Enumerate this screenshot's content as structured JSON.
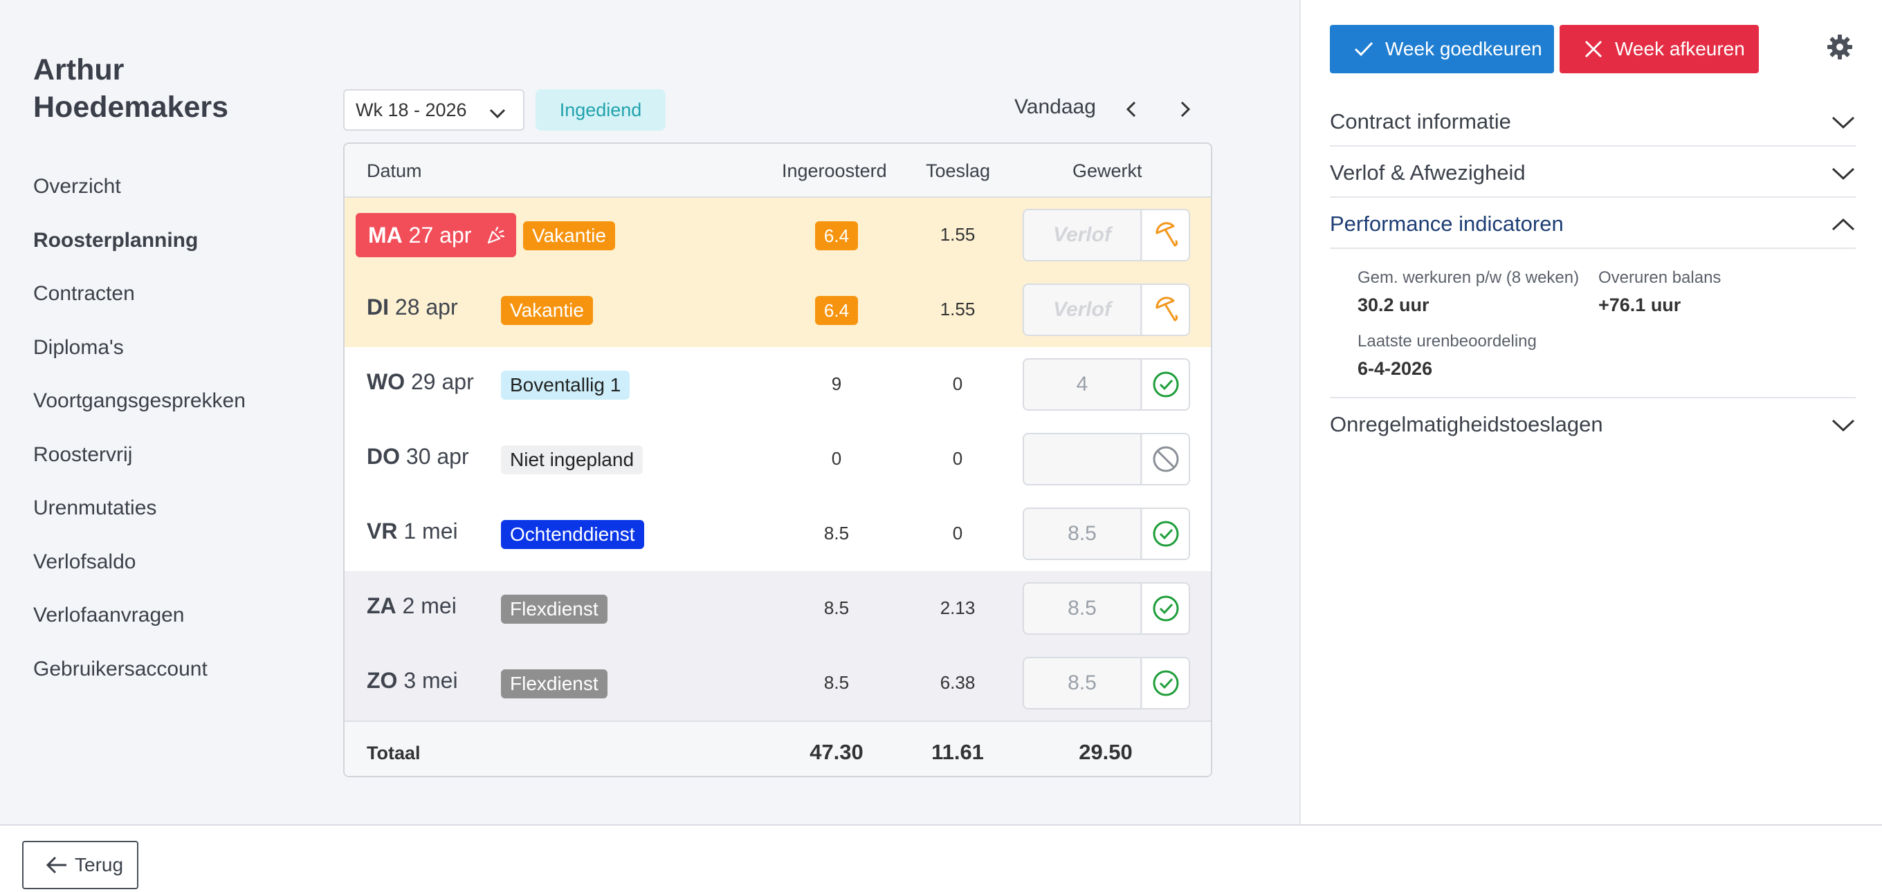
{
  "user": {
    "name_line1": "Arthur",
    "name_line2": "Hoedemakers"
  },
  "nav": [
    {
      "label": "Overzicht"
    },
    {
      "label": "Roosterplanning",
      "active": true
    },
    {
      "label": "Contracten"
    },
    {
      "label": "Diploma's"
    },
    {
      "label": "Voortgangsgesprekken"
    },
    {
      "label": "Roostervrij"
    },
    {
      "label": "Urenmutaties"
    },
    {
      "label": "Verlofsaldo"
    },
    {
      "label": "Verlofaanvragen"
    },
    {
      "label": "Gebruikersaccount"
    }
  ],
  "toolbar": {
    "week": "Wk 18 - 2026",
    "status": "Ingediend",
    "today": "Vandaag"
  },
  "table": {
    "headers": {
      "date": "Datum",
      "scheduled": "Ingeroosterd",
      "allowance": "Toeslag",
      "worked": "Gewerkt"
    },
    "rows": [
      {
        "dow": "MA",
        "date": "27 apr",
        "tag": "Vakantie",
        "scheduled": "6.4",
        "allowance": "1.55",
        "worked": "Verlof",
        "icon": "umbrella-icon"
      },
      {
        "dow": "DI",
        "date": "28 apr",
        "tag": "Vakantie",
        "scheduled": "6.4",
        "allowance": "1.55",
        "worked": "Verlof",
        "icon": "umbrella-icon"
      },
      {
        "dow": "WO",
        "date": "29 apr",
        "tag": "Boventallig 1",
        "scheduled": "9",
        "allowance": "0",
        "worked": "4",
        "icon": "check-circle-icon"
      },
      {
        "dow": "DO",
        "date": "30 apr",
        "tag": "Niet ingepland",
        "scheduled": "0",
        "allowance": "0",
        "worked": "",
        "icon": "blocked-icon"
      },
      {
        "dow": "VR",
        "date": "1 mei",
        "tag": "Ochtenddienst",
        "scheduled": "8.5",
        "allowance": "0",
        "worked": "8.5",
        "icon": "check-circle-icon"
      },
      {
        "dow": "ZA",
        "date": "2 mei",
        "tag": "Flexdienst",
        "scheduled": "8.5",
        "allowance": "2.13",
        "worked": "8.5",
        "icon": "check-circle-icon"
      },
      {
        "dow": "ZO",
        "date": "3 mei",
        "tag": "Flexdienst",
        "scheduled": "8.5",
        "allowance": "6.38",
        "worked": "8.5",
        "icon": "check-circle-icon"
      }
    ],
    "totals": {
      "label": "Totaal",
      "scheduled": "47.30",
      "allowance": "11.61",
      "worked": "29.50"
    }
  },
  "panel": {
    "approve": "Week goedkeuren",
    "reject": "Week afkeuren",
    "sections": {
      "contract": "Contract informatie",
      "leave": "Verlof & Afwezigheid",
      "performance": "Performance indicatoren",
      "irregular": "Onregelmatigheidstoeslagen"
    },
    "kpis": {
      "avg_label": "Gem. werkuren p/w (8 weken)",
      "avg_value": "30.2 uur",
      "overtime_label": "Overuren balans",
      "overtime_value": "+76.1 uur",
      "last_review_label": "Laatste urenbeoordeling",
      "last_review_value": "6-4-2026"
    }
  },
  "footer": {
    "back": "Terug"
  },
  "colors": {
    "approve": "#1f7ed1",
    "reject": "#e42d44",
    "leave_row": "#fdf1d1",
    "weekend_row": "#efeff4",
    "vakantie": "#f7940f",
    "ochtenddienst": "#0b36e8",
    "flexdienst": "#8f8f8f",
    "status_badge": "#d5f3f7",
    "check": "#1e9e3a"
  }
}
